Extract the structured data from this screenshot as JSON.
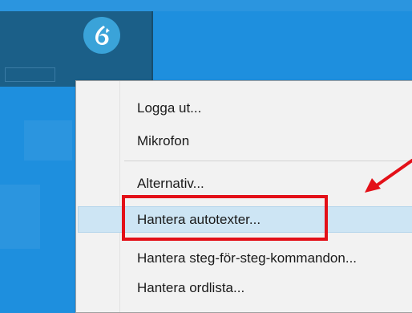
{
  "app": {
    "icon": "dragon-logo-icon"
  },
  "menu": {
    "items": [
      {
        "id": "logout",
        "label": "Logga ut..."
      },
      {
        "id": "microphone",
        "label": "Mikrofon"
      },
      {
        "id": "options",
        "label": "Alternativ..."
      },
      {
        "id": "manage-autotexts",
        "label": "Hantera autotexter..."
      },
      {
        "id": "manage-step-commands",
        "label": "Hantera steg-för-steg-kommandon..."
      },
      {
        "id": "manage-vocabulary",
        "label": "Hantera ordlista..."
      }
    ],
    "highlighted_item": "Hantera autotexter..."
  },
  "annotation": {
    "color": "#e31018",
    "box_target": "Hantera autotexter...",
    "arrow": "red-arrow-icon"
  },
  "colors": {
    "desktop": "#1e8fde",
    "taskbar": "#1b5f88",
    "app_icon": "#3aa3d9",
    "menu_bg": "#f2f2f2",
    "hover": "#cde5f4"
  }
}
